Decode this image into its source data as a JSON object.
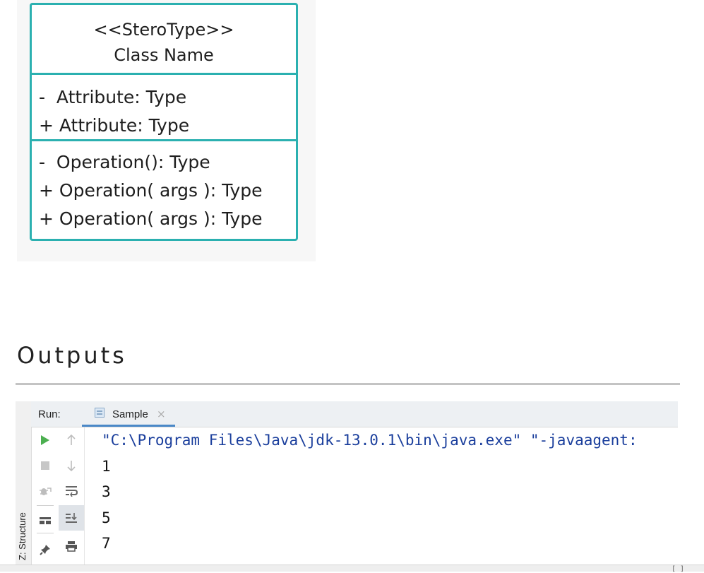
{
  "uml": {
    "stereotype": "<<SteroType>>",
    "class_name": "Class Name",
    "attributes": [
      "-  Attribute: Type",
      "+ Attribute: Type"
    ],
    "operations": [
      "-  Operation(): Type",
      "+ Operation( args ): Type",
      "+ Operation( args ): Type"
    ],
    "border_color": "#2bb0b0"
  },
  "outputs_heading": "Outputs",
  "run_panel": {
    "run_label": "Run:",
    "tab_label": "Sample",
    "tab_close": "×",
    "sidebar_label": "Z: Structure",
    "console_lines": [
      "\"C:\\Program Files\\Java\\jdk-13.0.1\\bin\\java.exe\" \"-javaagent:",
      "1",
      "3",
      "5",
      "7"
    ],
    "toolbar_left": [
      "run-icon",
      "stop-icon",
      "debug-icon",
      "layout-icon",
      "pin-icon"
    ],
    "toolbar_right": [
      "up-arrow-icon",
      "down-arrow-icon",
      "soft-wrap-icon",
      "scroll-to-end-icon",
      "print-icon"
    ],
    "accent": "#4a88c7"
  },
  "footer_bracket": "[ ]"
}
